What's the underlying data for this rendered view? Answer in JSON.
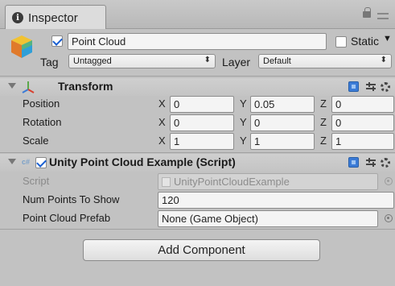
{
  "tab": {
    "label": "Inspector"
  },
  "gameobject": {
    "active": true,
    "name": "Point Cloud",
    "static_label": "Static",
    "tag_label": "Tag",
    "tag_value": "Untagged",
    "layer_label": "Layer",
    "layer_value": "Default"
  },
  "transform": {
    "title": "Transform",
    "rows": [
      {
        "label": "Position",
        "x": "0",
        "y": "0.05",
        "z": "0"
      },
      {
        "label": "Rotation",
        "x": "0",
        "y": "0",
        "z": "0"
      },
      {
        "label": "Scale",
        "x": "1",
        "y": "1",
        "z": "1"
      }
    ],
    "axis_x": "X",
    "axis_y": "Y",
    "axis_z": "Z"
  },
  "script_component": {
    "enabled": true,
    "title": "Unity Point Cloud Example (Script)",
    "script_label": "Script",
    "script_value": "UnityPointCloudExample",
    "num_points_label": "Num Points To Show",
    "num_points_value": "120",
    "prefab_label": "Point Cloud Prefab",
    "prefab_value": "None (Game Object)"
  },
  "add_component": {
    "label": "Add Component"
  },
  "colors": {
    "accent": "#3b7bd6",
    "panel_bg": "#c2c2c2"
  }
}
